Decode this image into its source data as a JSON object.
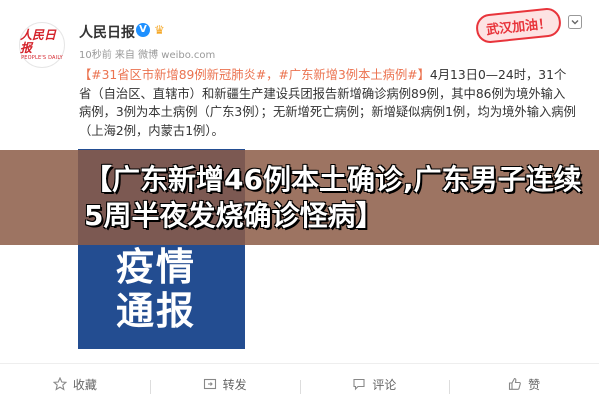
{
  "header": {
    "avatar_text": "人民日报",
    "avatar_subtext": "PEOPLE'S DAILY",
    "user_name": "人民日报",
    "meta": "10秒前 来自 微博 weibo.com",
    "sticker": "武汉加油！"
  },
  "post": {
    "tag1": "【#31省区市新增89例新冠肺炎#，#广东新增3例本土病例#】",
    "text": "4月13日0—24时，31个省（自治区、直辖市）和新疆生产建设兵团报告新增确诊病例89例，其中86例为境外输入病例，3例为本土病例（广东3例）；无新增死亡病例；新增疑似病例1例，均为境外输入病例（上海2例，内蒙古1例）。"
  },
  "banner": {
    "text": "【广东新增46例本土确诊,广东男子连续5周半夜发烧确诊怪病】"
  },
  "image_card": {
    "line1": "疫情",
    "line2": "通报"
  },
  "footer": {
    "collect": "收藏",
    "repost": "转发",
    "comment": "评论",
    "like": "赞"
  }
}
